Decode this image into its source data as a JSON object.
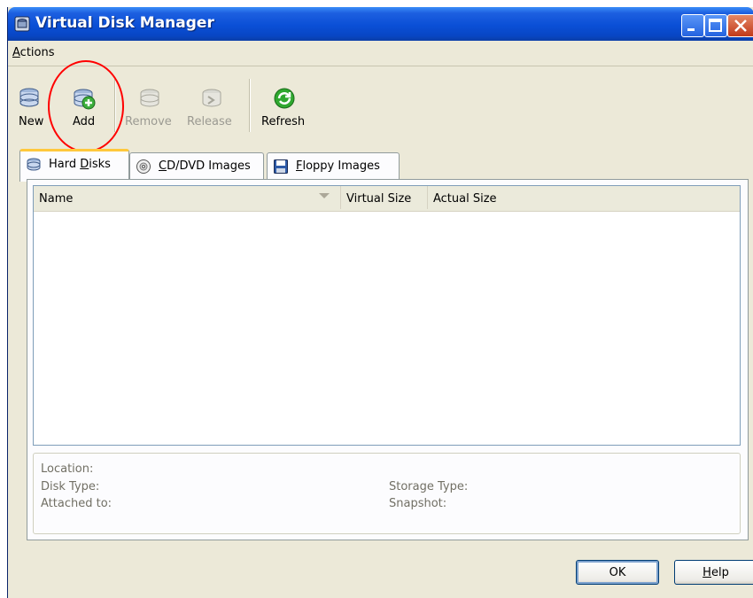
{
  "window": {
    "title": "Virtual Disk Manager",
    "icon": "virtual-disk-manager-icon",
    "controls": [
      "minimize-icon",
      "maximize-icon",
      "close-icon"
    ]
  },
  "menu": {
    "items": [
      {
        "label": "Actions",
        "mnemonic": "A"
      }
    ]
  },
  "toolbar": {
    "buttons": [
      {
        "label": "New",
        "icon": "new-disk-icon",
        "enabled": true
      },
      {
        "label": "Add",
        "icon": "add-disk-icon",
        "enabled": true
      },
      {
        "label": "Remove",
        "icon": "remove-disk-icon",
        "enabled": false
      },
      {
        "label": "Release",
        "icon": "release-disk-icon",
        "enabled": false
      },
      {
        "label": "Refresh",
        "icon": "refresh-icon",
        "enabled": true
      }
    ]
  },
  "tabs": [
    {
      "label": "Hard Disks",
      "mnemonic": "D",
      "icon": "hard-disk-icon",
      "active": true
    },
    {
      "label": "CD/DVD Images",
      "mnemonic": "C",
      "icon": "cd-dvd-icon",
      "active": false
    },
    {
      "label": "Floppy Images",
      "mnemonic": "F",
      "icon": "floppy-icon",
      "active": false
    }
  ],
  "table": {
    "columns": [
      "Name",
      "Virtual Size",
      "Actual Size"
    ],
    "rows": []
  },
  "details": {
    "location": "Location:",
    "disk_type": "Disk Type:",
    "attached_to": "Attached to:",
    "storage_type": "Storage Type:",
    "snapshot": "Snapshot:"
  },
  "buttons": {
    "ok": "OK",
    "help": "Help",
    "help_mnemonic": "H"
  },
  "colors": {
    "titlebar": "#0a4fd6",
    "window_bg": "#ece9d8",
    "active_tab_accent": "#ffc83c",
    "annotation_circle": "#ff0000",
    "refresh_green": "#2fa82f"
  }
}
